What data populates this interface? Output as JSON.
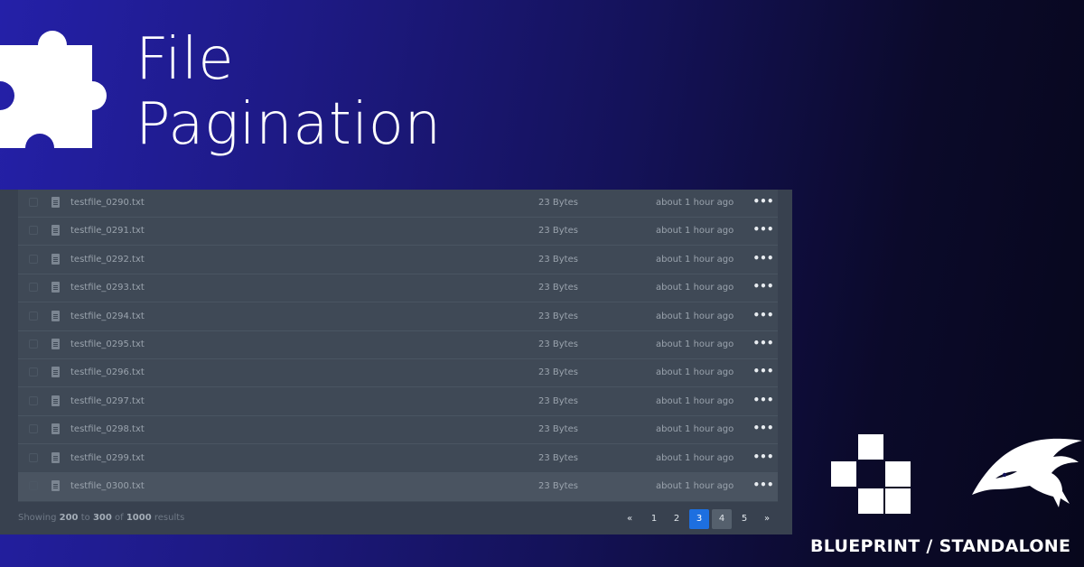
{
  "header": {
    "title_line1": "File",
    "title_line2": "Pagination",
    "logo_icon": "puzzle-piece-icon"
  },
  "files": [
    {
      "name": "testfile_0290.txt",
      "size": "23 Bytes",
      "modified": "about 1 hour ago"
    },
    {
      "name": "testfile_0291.txt",
      "size": "23 Bytes",
      "modified": "about 1 hour ago"
    },
    {
      "name": "testfile_0292.txt",
      "size": "23 Bytes",
      "modified": "about 1 hour ago"
    },
    {
      "name": "testfile_0293.txt",
      "size": "23 Bytes",
      "modified": "about 1 hour ago"
    },
    {
      "name": "testfile_0294.txt",
      "size": "23 Bytes",
      "modified": "about 1 hour ago"
    },
    {
      "name": "testfile_0295.txt",
      "size": "23 Bytes",
      "modified": "about 1 hour ago"
    },
    {
      "name": "testfile_0296.txt",
      "size": "23 Bytes",
      "modified": "about 1 hour ago"
    },
    {
      "name": "testfile_0297.txt",
      "size": "23 Bytes",
      "modified": "about 1 hour ago"
    },
    {
      "name": "testfile_0298.txt",
      "size": "23 Bytes",
      "modified": "about 1 hour ago"
    },
    {
      "name": "testfile_0299.txt",
      "size": "23 Bytes",
      "modified": "about 1 hour ago"
    },
    {
      "name": "testfile_0300.txt",
      "size": "23 Bytes",
      "modified": "about 1 hour ago"
    }
  ],
  "row_actions_label": "•••",
  "footer": {
    "showing": "Showing",
    "from": "200",
    "to_word": "to",
    "to": "300",
    "of_word": "of",
    "total": "1000",
    "results_word": "results"
  },
  "pagination": {
    "prev": "«",
    "next": "»",
    "pages": [
      "1",
      "2",
      "3",
      "4",
      "5"
    ],
    "current": "3"
  },
  "brand": {
    "label": "BLUEPRINT / STANDALONE",
    "logos": [
      "blueprint-logo-icon",
      "raven-logo-icon"
    ]
  },
  "colors": {
    "accent": "#1d6fe0",
    "panel": "#38414f"
  }
}
